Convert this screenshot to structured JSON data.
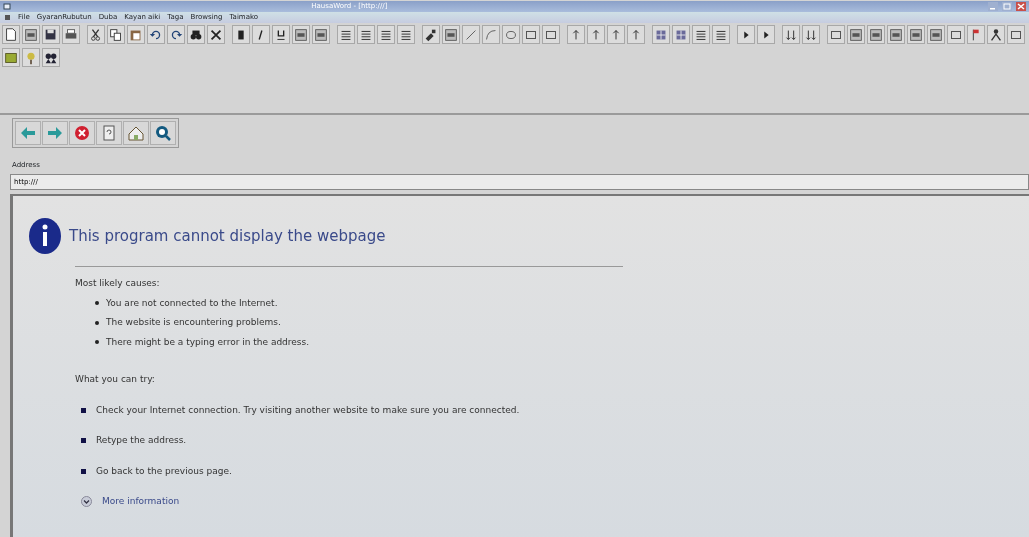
{
  "window": {
    "title": "HausaWord - [http:///]"
  },
  "menu": [
    "File",
    "GyaranRubutun",
    "Duba",
    "Kayan aiki",
    "Taga",
    "Browsing",
    "Taimako"
  ],
  "address": {
    "label": "Address",
    "value": "http:///"
  },
  "error_page": {
    "title": "This program cannot display the webpage",
    "causes_heading": "Most likely causes:",
    "causes": [
      "You are not connected to the Internet.",
      "The website is encountering problems.",
      "There might be a typing error in the address."
    ],
    "try_heading": "What you can try:",
    "suggestions": [
      "Check your Internet connection. Try visiting another website to make sure you are connected.",
      "Retype the address.",
      "Go back to the previous page."
    ],
    "more_link": "More information"
  }
}
